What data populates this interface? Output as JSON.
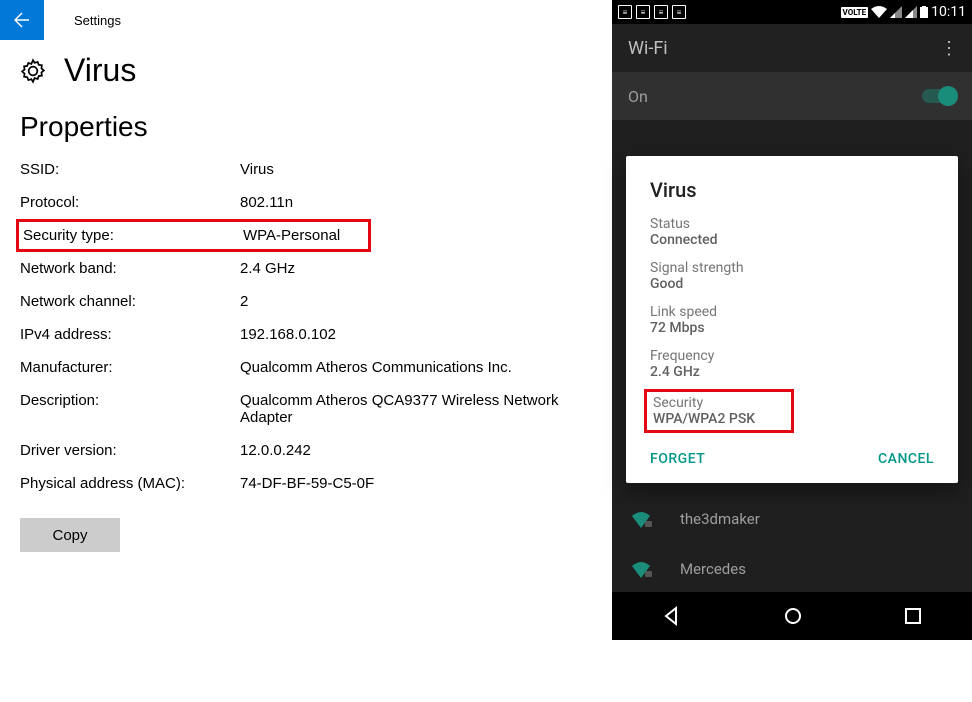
{
  "windows": {
    "titlebar": "Settings",
    "page_title": "Virus",
    "section": "Properties",
    "rows": {
      "ssid_k": "SSID:",
      "ssid_v": "Virus",
      "protocol_k": "Protocol:",
      "protocol_v": "802.11n",
      "security_k": "Security type:",
      "security_v": "WPA-Personal",
      "band_k": "Network band:",
      "band_v": "2.4 GHz",
      "channel_k": "Network channel:",
      "channel_v": "2",
      "ipv4_k": "IPv4 address:",
      "ipv4_v": "192.168.0.102",
      "mfr_k": "Manufacturer:",
      "mfr_v": "Qualcomm Atheros Communications Inc.",
      "desc_k": "Description:",
      "desc_v": "Qualcomm Atheros QCA9377 Wireless Network Adapter",
      "driver_k": "Driver version:",
      "driver_v": "12.0.0.242",
      "mac_k": "Physical address (MAC):",
      "mac_v": "74-DF-BF-59-C5-0F"
    },
    "copy_label": "Copy"
  },
  "android": {
    "status_time": "10:11",
    "volte": "VOLTE",
    "appbar_title": "Wi-Fi",
    "on_label": "On",
    "dialog": {
      "title": "Virus",
      "status_l": "Status",
      "status_v": "Connected",
      "signal_l": "Signal strength",
      "signal_v": "Good",
      "speed_l": "Link speed",
      "speed_v": "72 Mbps",
      "freq_l": "Frequency",
      "freq_v": "2.4 GHz",
      "sec_l": "Security",
      "sec_v": "WPA/WPA2 PSK",
      "forget": "FORGET",
      "cancel": "CANCEL"
    },
    "networks": {
      "n1": "the3dmaker",
      "n2": "Mercedes"
    }
  }
}
